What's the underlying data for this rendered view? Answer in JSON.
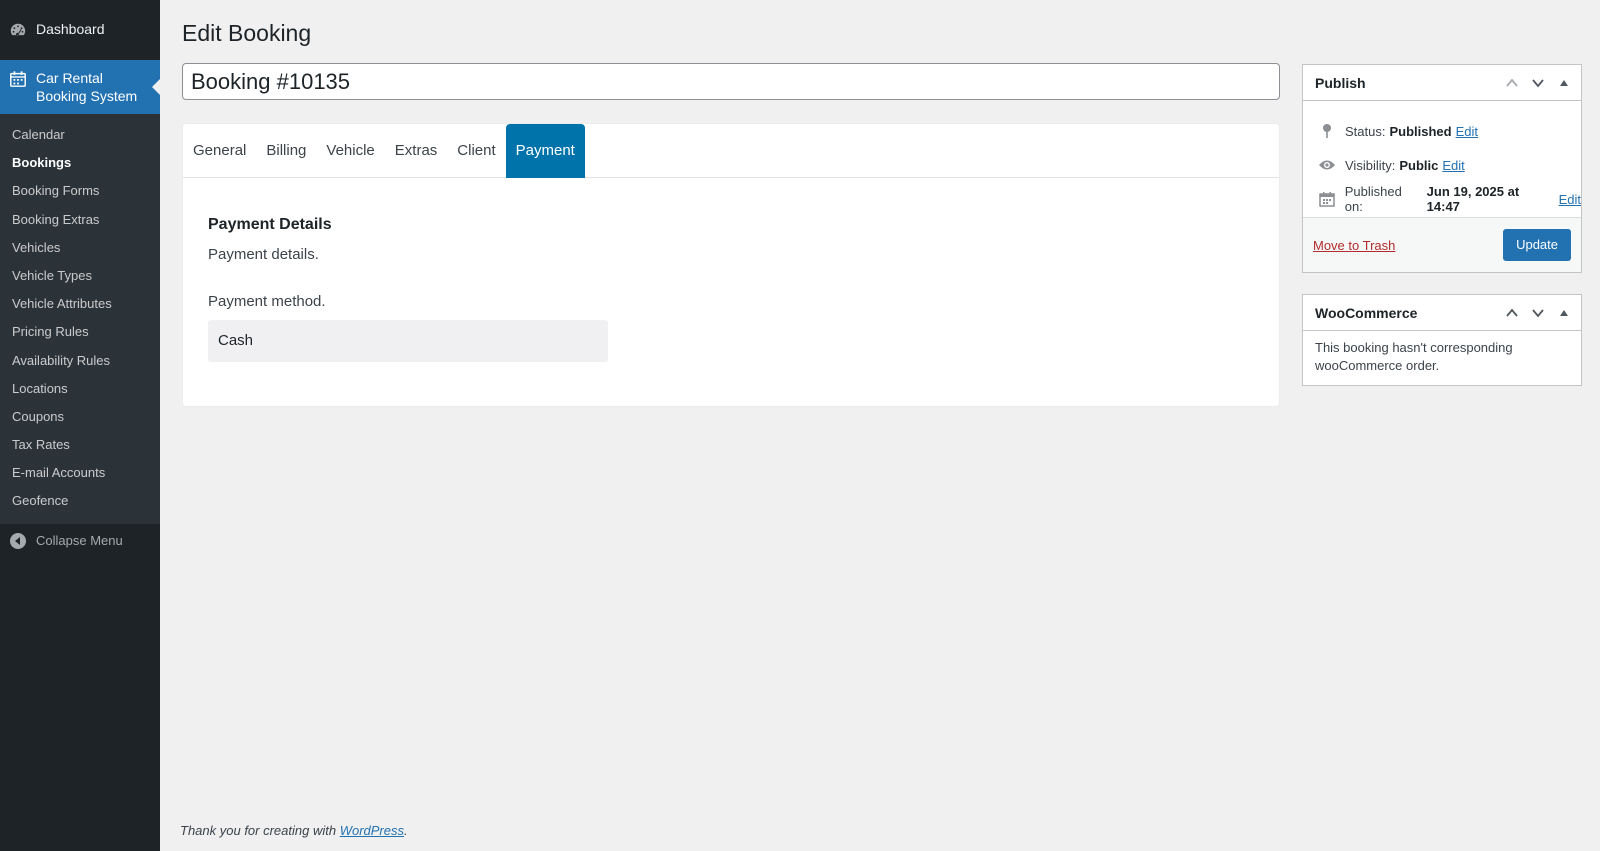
{
  "sidebar": {
    "dashboard_label": "Dashboard",
    "plugin_label_line1": "Car Rental",
    "plugin_label_line2": "Booking System",
    "items": [
      {
        "label": "Calendar"
      },
      {
        "label": "Bookings",
        "current": true
      },
      {
        "label": "Booking Forms"
      },
      {
        "label": "Booking Extras"
      },
      {
        "label": "Vehicles"
      },
      {
        "label": "Vehicle Types"
      },
      {
        "label": "Vehicle Attributes"
      },
      {
        "label": "Pricing Rules"
      },
      {
        "label": "Availability Rules"
      },
      {
        "label": "Locations"
      },
      {
        "label": "Coupons"
      },
      {
        "label": "Tax Rates"
      },
      {
        "label": "E-mail Accounts"
      },
      {
        "label": "Geofence"
      }
    ],
    "collapse_label": "Collapse Menu"
  },
  "page": {
    "title": "Edit Booking",
    "post_title": "Booking #10135"
  },
  "tabs": [
    {
      "label": "General"
    },
    {
      "label": "Billing"
    },
    {
      "label": "Vehicle"
    },
    {
      "label": "Extras"
    },
    {
      "label": "Client"
    },
    {
      "label": "Payment",
      "active": true
    }
  ],
  "panel": {
    "heading": "Payment Details",
    "description": "Payment details.",
    "method_label": "Payment method.",
    "method_value": "Cash"
  },
  "publish": {
    "title": "Publish",
    "status_label": "Status:",
    "status_value": "Published",
    "visibility_label": "Visibility:",
    "visibility_value": "Public",
    "published_label": "Published on:",
    "published_value": "Jun 19, 2025 at 14:47",
    "edit_label": "Edit",
    "trash_label": "Move to Trash",
    "update_label": "Update"
  },
  "woocommerce": {
    "title": "WooCommerce",
    "message": "This booking hasn't corresponding wooCommerce order."
  },
  "footer": {
    "text": "Thank you for creating with",
    "link": "WordPress",
    "suffix": "."
  },
  "colors": {
    "sidebar_bg": "#1d2327",
    "accent": "#2271b1",
    "tab_active": "#0073aa",
    "trash": "#b32d2e"
  }
}
